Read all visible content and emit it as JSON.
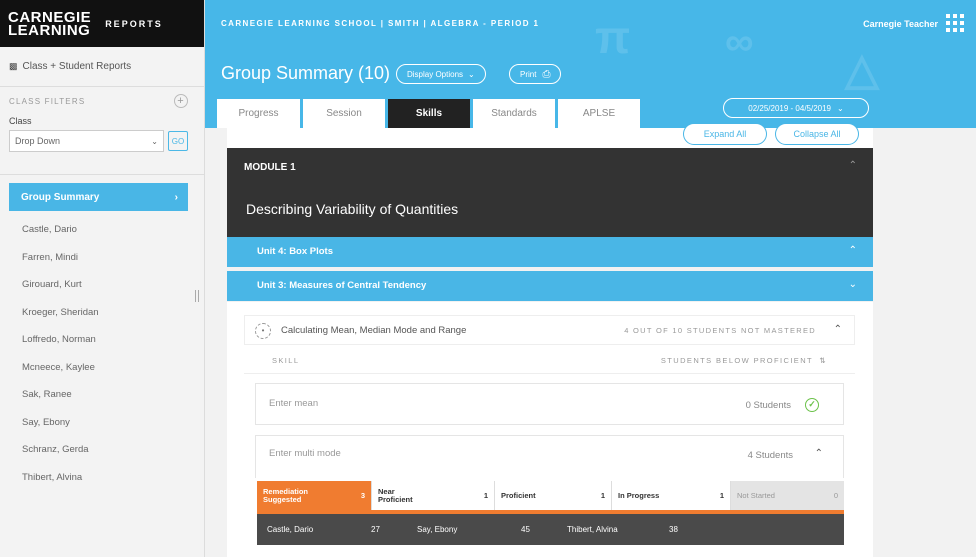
{
  "colors": {
    "accent": "#49b6e6",
    "dark": "#333333",
    "orange": "#f07c30",
    "green": "#6cc24a"
  },
  "brand": {
    "line1": "CARNEGIE",
    "line2": "LEARNING",
    "suffix": "REPORTS"
  },
  "sidebar": {
    "reports_link": "Class + Student Reports",
    "filters_label": "CLASS FILTERS",
    "class_label": "Class",
    "dropdown_value": "Drop Down",
    "go_label": "GO",
    "group_summary": "Group Summary",
    "students": [
      "Castle, Dario",
      "Farren, Mindi",
      "Girouard, Kurt",
      "Kroeger, Sheridan",
      "Loffredo, Norman",
      "Mcneece, Kaylee",
      "Sak, Ranee",
      "Say, Ebony",
      "Schranz, Gerda",
      "Thibert, Alvina"
    ]
  },
  "header": {
    "breadcrumb": "CARNEGIE LEARNING SCHOOL | SMITH | ALGEBRA - PERIOD 1",
    "user": "Carnegie Teacher",
    "title": "Group Summary (10)",
    "display_options": "Display Options",
    "print": "Print",
    "tabs": [
      "Progress",
      "Session",
      "Skills",
      "Standards",
      "APLSE"
    ],
    "active_tab": "Skills",
    "date_range": "02/25/2019 - 04/5/2019"
  },
  "content": {
    "expand_all": "Expand All",
    "collapse_all": "Collapse All",
    "module_title": "MODULE 1",
    "module_subtitle": "Describing Variability of Quantities",
    "unit4": "Unit 4: Box Plots",
    "unit3": "Unit 3: Measures of Central Tendency",
    "topic": "Calculating Mean, Median Mode and Range",
    "topic_status": "4 OUT OF 10 STUDENTS NOT MASTERED",
    "col_skill": "SKILL",
    "col_below": "STUDENTS BELOW PROFICIENT",
    "skills": [
      {
        "name": "Enter mean",
        "count": "0 Students"
      },
      {
        "name": "Enter multi mode",
        "count": "4 Students"
      }
    ],
    "proficiency": [
      {
        "label": "Remediation Suggested",
        "count": "3"
      },
      {
        "label": "Near Proficient",
        "count": "1"
      },
      {
        "label": "Proficient",
        "count": "1"
      },
      {
        "label": "In Progress",
        "count": "1"
      },
      {
        "label": "Not Started",
        "count": "0"
      }
    ],
    "remediation_students": [
      {
        "name": "Castle, Dario",
        "score": "27"
      },
      {
        "name": "Say, Ebony",
        "score": "45"
      },
      {
        "name": "Thibert, Alvina",
        "score": "38"
      }
    ]
  }
}
